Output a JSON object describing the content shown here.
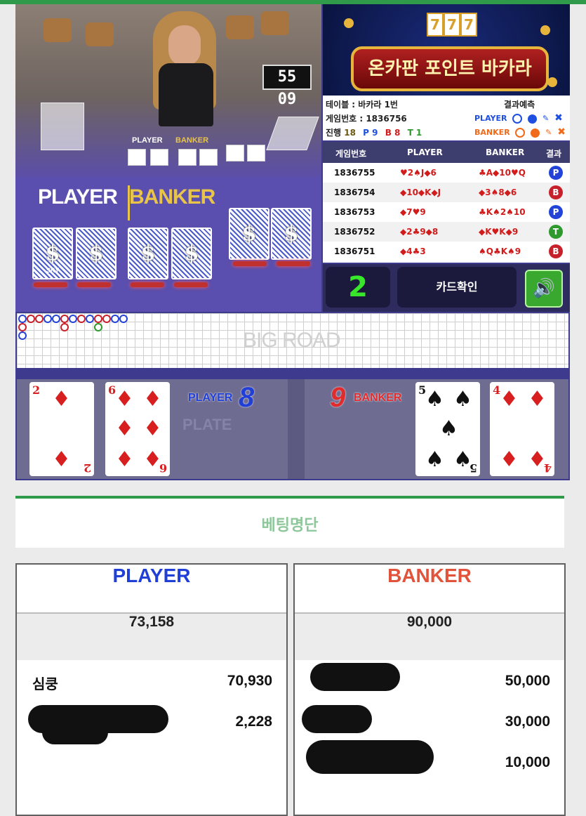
{
  "video": {
    "timer": "55 09",
    "mini_label_player": "PLAYER",
    "mini_label_banker": "BANKER",
    "table_label_player": "PLAYER",
    "table_label_banker": "BANKER",
    "card_back_text": "SKY",
    "card_back_logo": "$"
  },
  "banner": {
    "slots": [
      "7",
      "7",
      "7"
    ],
    "title": "온카판 포인트 바카라"
  },
  "info": {
    "table": "테이블 : 바카라 1번",
    "game_no": "게임번호 : 1836756",
    "prediction_label": "결과예측",
    "progress_label": "진행",
    "progress_total": "18",
    "progress_p": "P 9",
    "progress_b": "B 8",
    "progress_t": "T 1",
    "player_label": "PLAYER",
    "banker_label": "BANKER",
    "colors": {
      "player": "#1e4fe0",
      "banker": "#f06a1a"
    }
  },
  "history": {
    "headers": [
      "게임번호",
      "PLAYER",
      "BANKER",
      "결과"
    ],
    "rows": [
      {
        "num": "1836755",
        "player": "♥2♠J◆6",
        "banker": "♣A◆10♥Q",
        "result": "P"
      },
      {
        "num": "1836754",
        "player": "◆10◆K◆J",
        "banker": "◆3♠8◆6",
        "result": "B"
      },
      {
        "num": "1836753",
        "player": "◆7♥9",
        "banker": "♣K♠2♠10",
        "result": "P"
      },
      {
        "num": "1836752",
        "player": "◆2♣9◆8",
        "banker": "◆K♥K◆9",
        "result": "T"
      },
      {
        "num": "1836751",
        "player": "◆4♣3",
        "banker": "♠Q♣K♠9",
        "result": "B"
      }
    ],
    "badge_colors": {
      "P": "#2343d8",
      "B": "#c8202a",
      "T": "#2e9a2e"
    }
  },
  "controls": {
    "number": "2",
    "card_check": "카드확인",
    "sound_icon": "speaker-icon"
  },
  "bigroad": {
    "title": "BIG ROAD"
  },
  "result": {
    "player_label": "PLAYER",
    "player_score": "8",
    "banker_label": "BANKER",
    "banker_score": "9",
    "watermark": "PLATE",
    "player_cards": [
      {
        "rank": "2",
        "suit": "♦",
        "color": "red"
      },
      {
        "rank": "6",
        "suit": "♦",
        "color": "red"
      }
    ],
    "banker_cards": [
      {
        "rank": "5",
        "suit": "♠",
        "color": "black"
      },
      {
        "rank": "4",
        "suit": "♦",
        "color": "red"
      }
    ]
  },
  "betting": {
    "title": "베팅명단",
    "player": {
      "label": "PLAYER",
      "total": "73,158",
      "entries": [
        {
          "name": "심쿵",
          "amount": "70,930"
        },
        {
          "name": "",
          "amount": "2,228"
        }
      ],
      "color": "#1f3fd6"
    },
    "banker": {
      "label": "BANKER",
      "total": "90,000",
      "entries": [
        {
          "name": "",
          "amount": "50,000"
        },
        {
          "name": "",
          "amount": "30,000"
        },
        {
          "name": "",
          "amount": "10,000"
        }
      ],
      "color": "#e2533b"
    }
  }
}
